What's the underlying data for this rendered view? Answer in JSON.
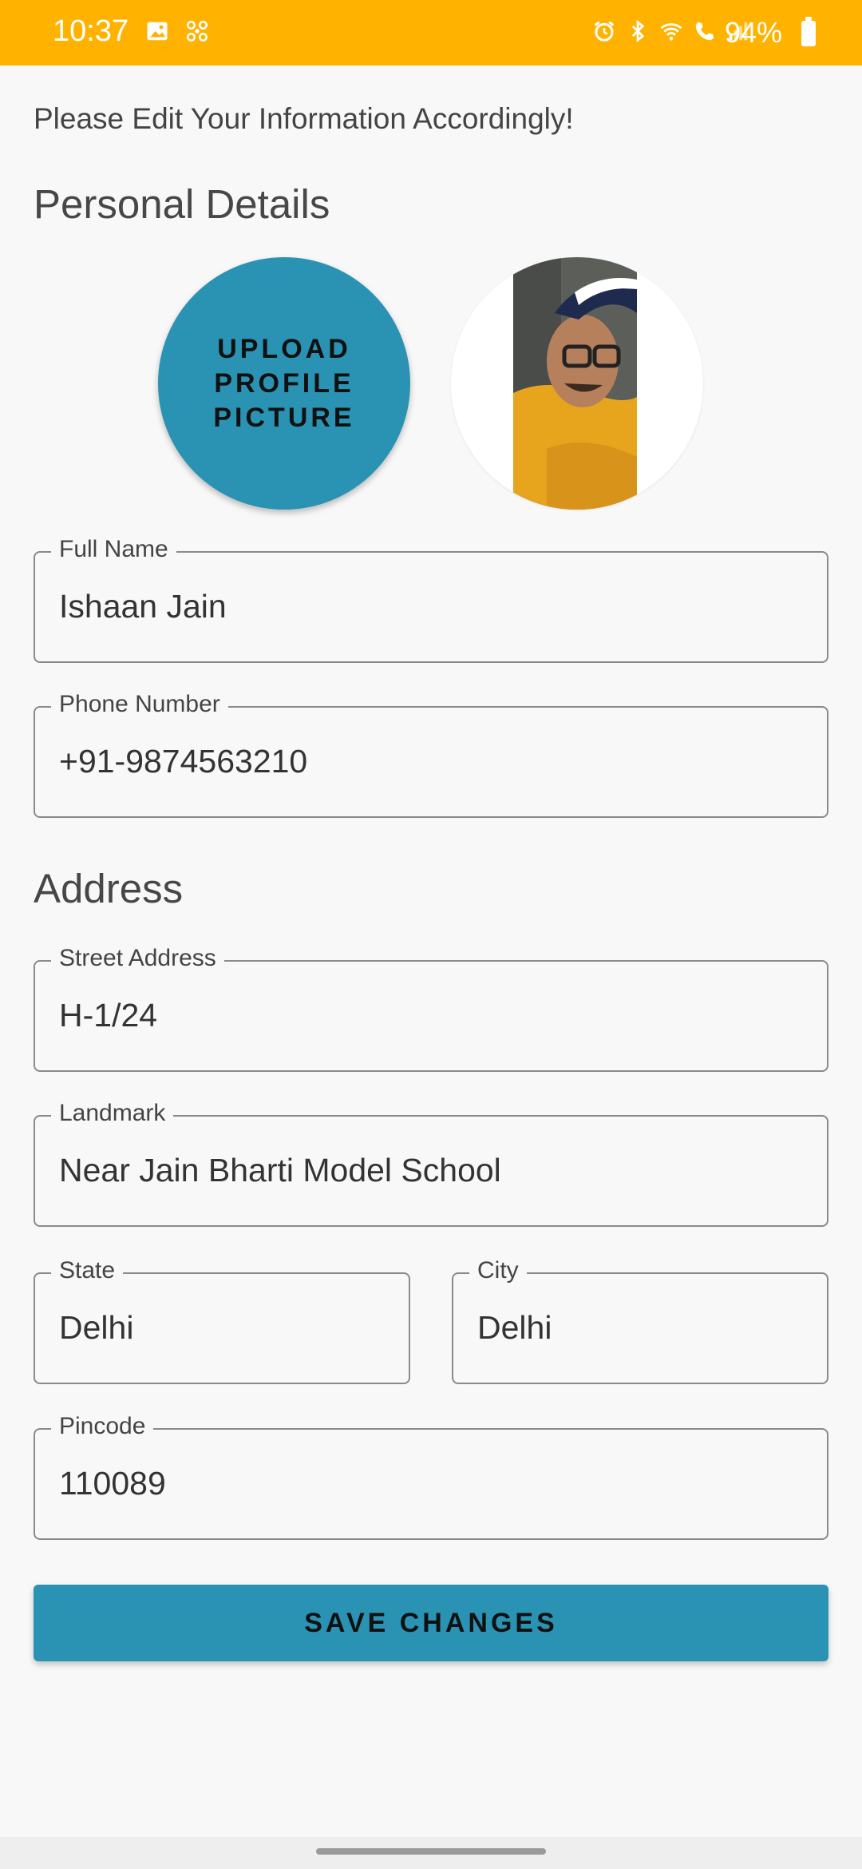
{
  "status_bar": {
    "time": "10:37",
    "battery": "94%",
    "left_icons": [
      "gallery-icon",
      "fan-icon"
    ],
    "right_icons": [
      "alarm-icon",
      "bluetooth-icon",
      "wifi-icon",
      "call-icon",
      "signal-icon"
    ]
  },
  "intro_text": "Please Edit Your Information Accordingly!",
  "sections": {
    "personal": "Personal Details",
    "address": "Address"
  },
  "upload_button": "UPLOAD\nPROFILE\nPICTURE",
  "fields": {
    "full_name": {
      "label": "Full Name",
      "value": "Ishaan Jain"
    },
    "phone": {
      "label": "Phone Number",
      "value": "+91-9874563210"
    },
    "street": {
      "label": "Street Address",
      "value": "H-1/24"
    },
    "landmark": {
      "label": "Landmark",
      "value": "Near Jain Bharti Model School"
    },
    "state": {
      "label": "State",
      "value": "Delhi"
    },
    "city": {
      "label": "City",
      "value": "Delhi"
    },
    "pincode": {
      "label": "Pincode",
      "value": "110089"
    }
  },
  "save_button": "SAVE CHANGES",
  "colors": {
    "status_bar": "#ffb300",
    "accent": "#2a92b2",
    "background": "#f8f8f8"
  }
}
